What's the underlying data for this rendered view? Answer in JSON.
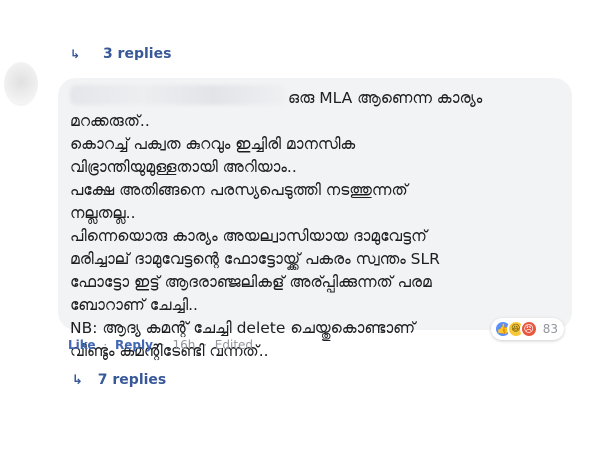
{
  "top_replies": {
    "label": "3 replies"
  },
  "comment": {
    "first_line": "ഒരു MLA ആണെന്ന കാര്യം",
    "body": "മറക്കരുത്..\nകൊറച്ച് പക്വത കുറവും ഇച്ചിരി മാനസിക\nവിഭ്രാന്തിയുമുള്ളതായി അറിയാം..\nപക്ഷേ അതിങ്ങനെ പരസ്യപെടുത്തി നടത്തുന്നത്\nനല്ലതല്ല..\nപിന്നെയൊരു കാര്യം അയല്വാസിയായ ദാമുവേട്ടന്\nമരിച്ചാല് ദാമുവേട്ടന്റെ ഫോട്ടോയ്ക്ക് പകരം സ്വന്തം SLR\nഫോട്ടോ ഇട്ട് ആദരാഞ്ജലികള് അര്പ്പിക്കുന്നത് പരമ\nബോറാണ് ചേച്ചി..\nNB: ആദ്യ കമന്റ് ചേച്ചി delete ചെയ്തുകൊണ്ടാണ്\nവീണ്ടും കമന്റിടേണ്ടി വന്നത്.."
  },
  "reactions": {
    "icons": [
      "like-icon",
      "haha-icon",
      "angry-icon"
    ],
    "count": "83",
    "colors": {
      "like": "#5890ff",
      "haha": "#f7c93b",
      "angry": "#e9573f"
    }
  },
  "actions": {
    "like": "Like",
    "reply": "Reply",
    "time": "16h",
    "edited": "Edited",
    "separator": "·"
  },
  "replies": {
    "label": "7 replies"
  },
  "colors": {
    "link": "#385898",
    "bubble": "#f2f3f5",
    "meta": "#90949c"
  }
}
